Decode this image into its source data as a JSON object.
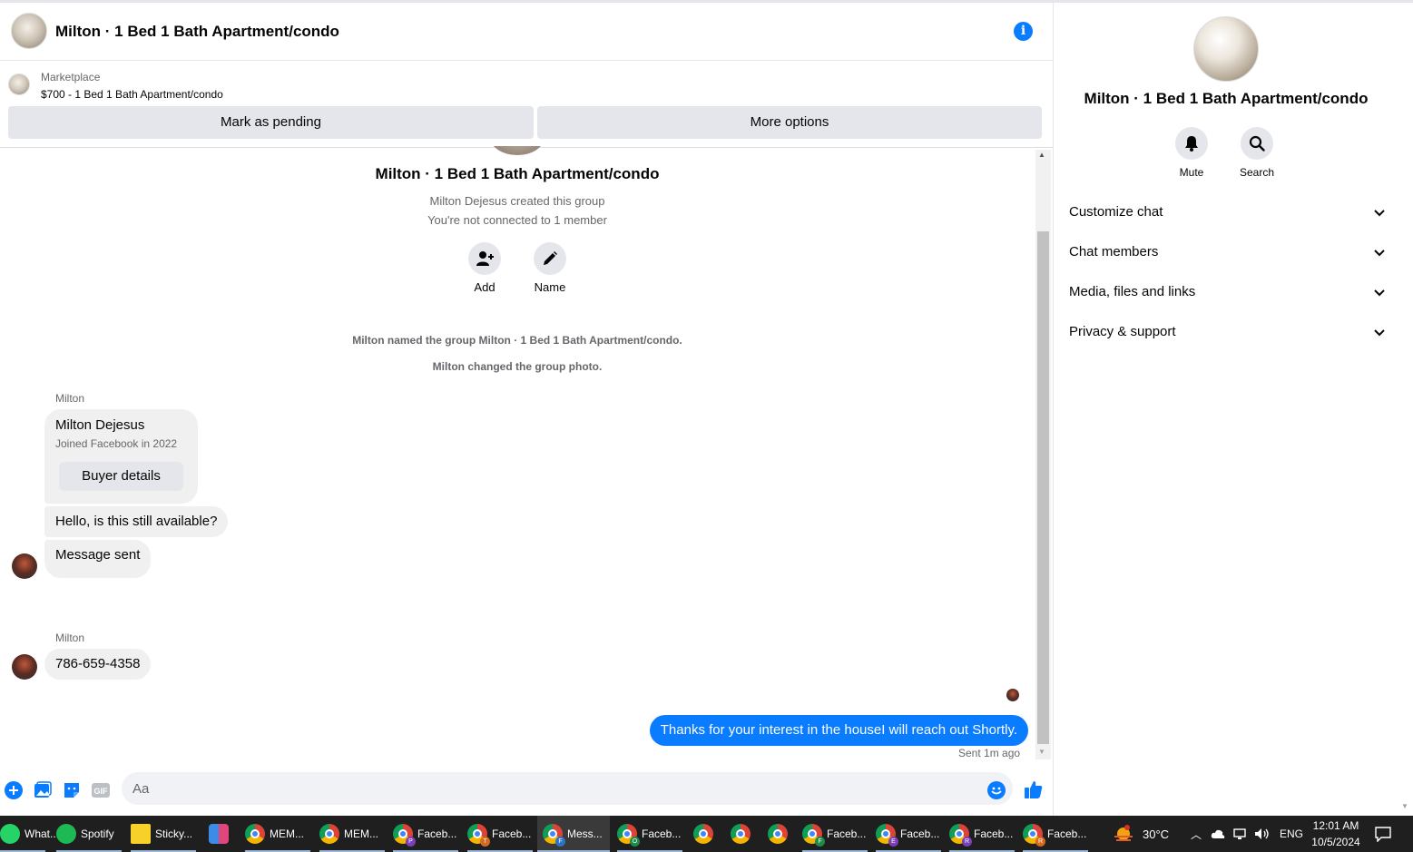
{
  "header": {
    "title": "Milton · 1 Bed 1 Bath Apartment/condo",
    "info_icon": "i"
  },
  "marketplace": {
    "label": "Marketplace",
    "listing": "$700 - 1 Bed 1 Bath Apartment/condo",
    "pending_label": "Mark as pending",
    "more_label": "More options"
  },
  "conversation": {
    "group_title": "Milton · 1 Bed 1 Bath Apartment/condo",
    "created_by": "Milton Dejesus created this group",
    "not_connected": "You're not connected to 1 member",
    "add_label": "Add",
    "name_label": "Name",
    "system_1": "Milton named the group Milton · 1 Bed 1 Bath Apartment/condo.",
    "system_2": "Milton changed the group photo.",
    "sender_1": "Milton",
    "card_name": "Milton Dejesus",
    "card_joined": "Joined Facebook in 2022",
    "card_button": "Buyer details",
    "message_1": "Hello, is this still available?",
    "message_2": "Message sent",
    "sender_2": "Milton",
    "message_3": "786-659-4358",
    "outgoing": "Thanks for your interest in the houseI will reach out Shortly.",
    "sent_status": "Sent 1m ago"
  },
  "composer": {
    "placeholder": "Aa"
  },
  "right_panel": {
    "title": "Milton · 1 Bed 1 Bath Apartment/condo",
    "mute_label": "Mute",
    "search_label": "Search",
    "sections": [
      "Customize chat",
      "Chat members",
      "Media, files and links",
      "Privacy & support"
    ]
  },
  "taskbar": {
    "items": [
      {
        "label": "What..."
      },
      {
        "label": "Spotify"
      },
      {
        "label": "Sticky..."
      },
      {
        "label": ""
      },
      {
        "label": "MEM..."
      },
      {
        "label": "MEM..."
      },
      {
        "label": "Faceb...",
        "badge": "P"
      },
      {
        "label": "Faceb...",
        "badge": "T"
      },
      {
        "label": "Mess...",
        "badge": "F"
      },
      {
        "label": "Faceb...",
        "badge": "O"
      },
      {
        "label": ""
      },
      {
        "label": ""
      },
      {
        "label": ""
      },
      {
        "label": "Faceb...",
        "badge": "F"
      },
      {
        "label": "Faceb...",
        "badge": "E"
      },
      {
        "label": "Faceb...",
        "badge": "R"
      },
      {
        "label": "Faceb...",
        "badge": "R"
      }
    ],
    "weather": "30°C",
    "language": "ENG",
    "time": "12:01 AM",
    "date": "10/5/2024"
  },
  "colors": {
    "messenger_blue": "#0a7cff",
    "bubble_gray": "#f0f0f0",
    "button_gray": "#e4e6eb"
  }
}
